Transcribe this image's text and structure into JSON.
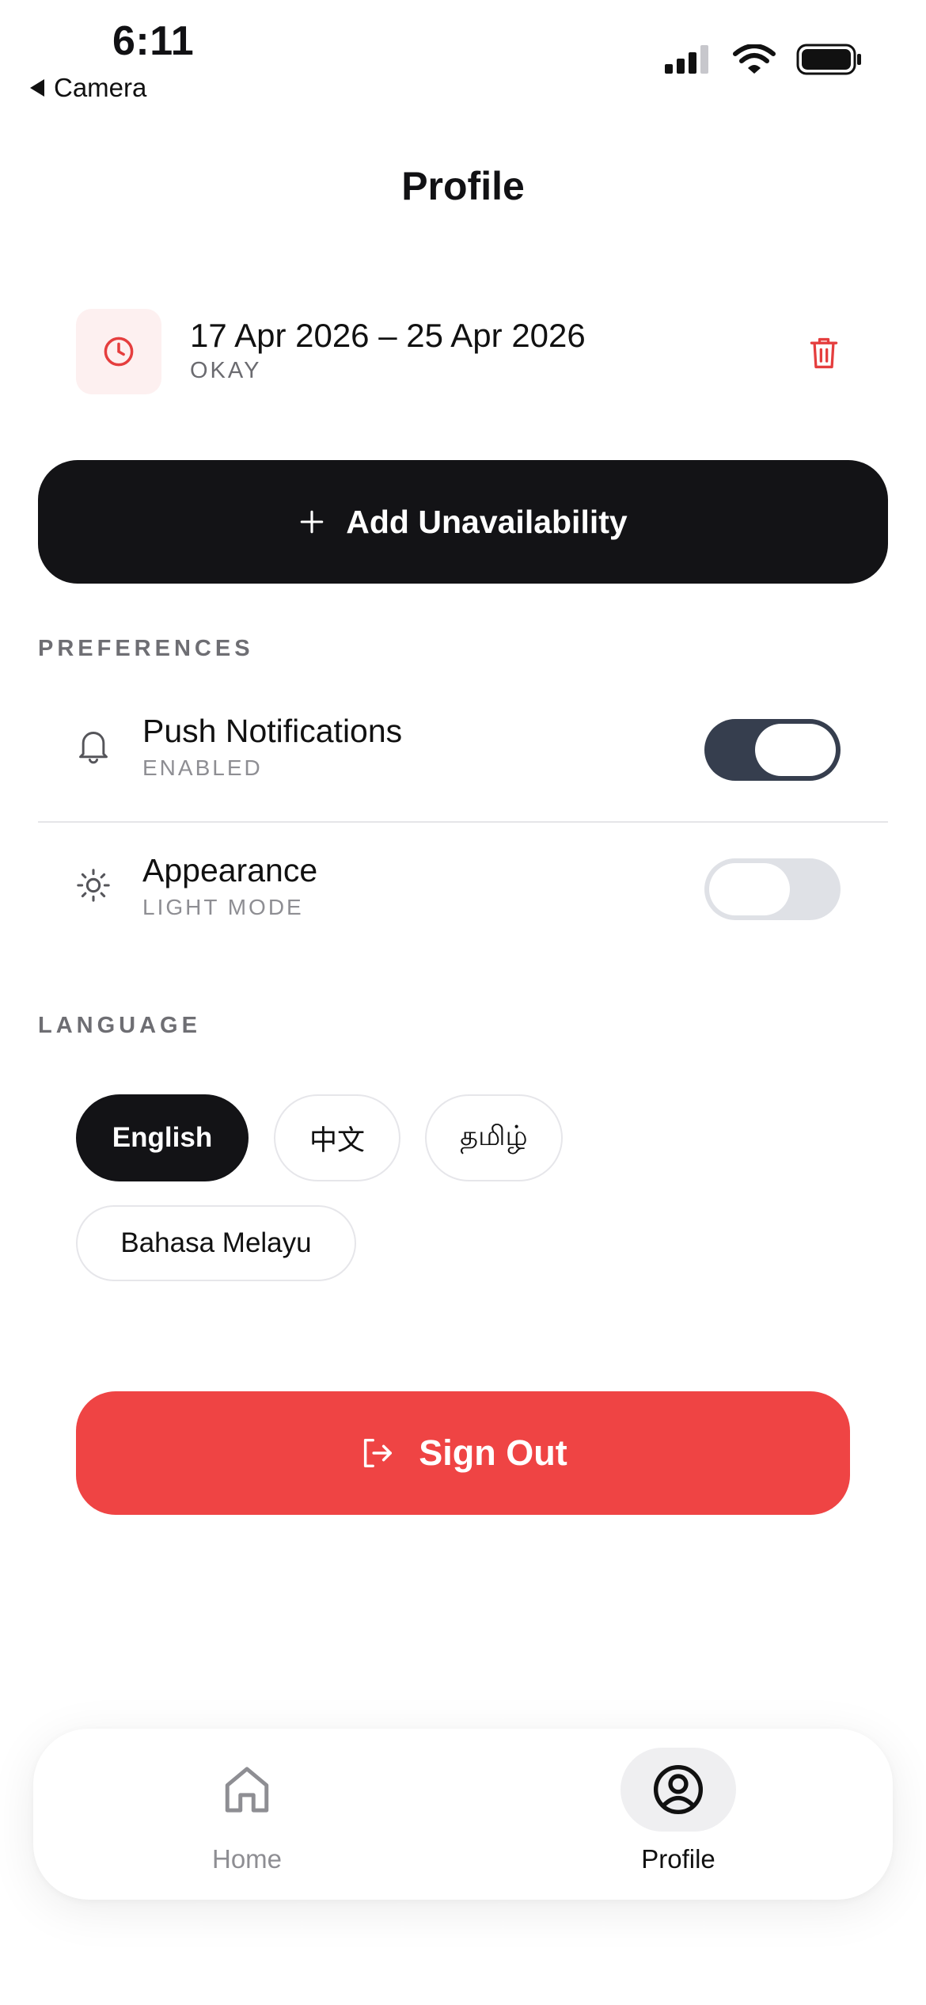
{
  "status_bar": {
    "time": "6:11",
    "back_app": "Camera",
    "icons": [
      "cellular-signal-icon",
      "wifi-icon",
      "battery-icon"
    ]
  },
  "page": {
    "title": "Profile"
  },
  "unavailability": {
    "date_range": "17 Apr 2026 – 25 Apr 2026",
    "status": "OKAY",
    "icon": "clock-icon",
    "delete_icon": "trash-icon"
  },
  "add_button": {
    "label": "Add Unavailability",
    "icon": "plus-icon"
  },
  "preferences": {
    "section_label": "PREFERENCES",
    "push": {
      "title": "Push Notifications",
      "subtitle": "ENABLED",
      "enabled": true,
      "icon": "bell-icon"
    },
    "appearance": {
      "title": "Appearance",
      "subtitle": "LIGHT MODE",
      "enabled": false,
      "icon": "sun-icon"
    }
  },
  "language": {
    "section_label": "LANGUAGE",
    "options": [
      "English",
      "中文",
      "தமிழ்",
      "Bahasa Melayu"
    ],
    "selected": "English"
  },
  "sign_out": {
    "label": "Sign Out",
    "icon": "sign-out-icon"
  },
  "bottom_nav": {
    "items": [
      {
        "label": "Home",
        "icon": "home-icon",
        "active": false
      },
      {
        "label": "Profile",
        "icon": "user-circle-icon",
        "active": true
      }
    ]
  },
  "colors": {
    "primary_dark": "#131316",
    "danger": "#ef4444",
    "toggle_on": "#363e4e",
    "toggle_off": "#dfe1e6",
    "muted_text": "#8e8e93"
  }
}
